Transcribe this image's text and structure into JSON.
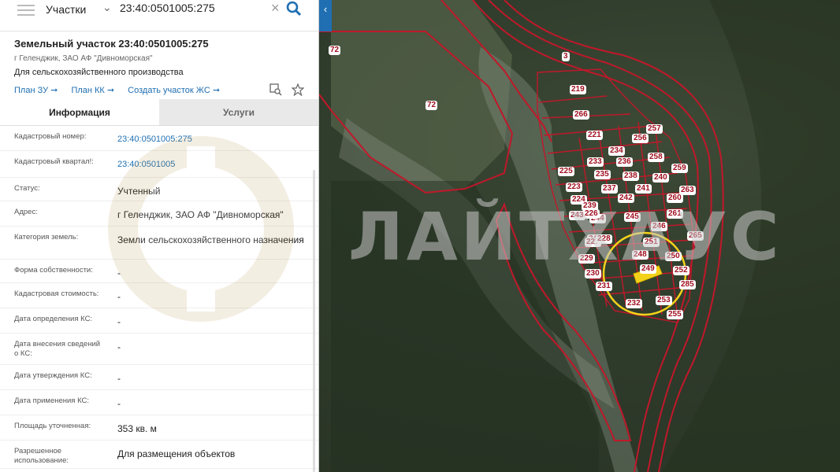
{
  "search": {
    "category": "Участки",
    "query": "23:40:0501005:275"
  },
  "object": {
    "title": "Земельный участок 23:40:0501005:275",
    "location": "г Геленджик, ЗАО АФ \"Дивноморская\"",
    "purpose": "Для сельскохозяйственного производства",
    "links": [
      {
        "label": "План ЗУ"
      },
      {
        "label": "План КК"
      },
      {
        "label": "Создать участок ЖС"
      }
    ]
  },
  "tabs": [
    {
      "label": "Информация",
      "active": true
    },
    {
      "label": "Услуги",
      "active": false
    }
  ],
  "info": [
    {
      "label": "Кадастровый номер:",
      "value": "23:40:0501005:275",
      "link": true
    },
    {
      "label": "Кадастровый квартал!:",
      "value": "23:40:0501005",
      "link": true
    },
    {
      "label": "Статус:",
      "value": "Учтенный"
    },
    {
      "label": "Адрес:",
      "value": "г Геленджик, ЗАО АФ \"Дивноморская\""
    },
    {
      "label": "Категория земель:",
      "value": "Земли сельскохозяйственного назначения"
    },
    {
      "label": "Форма собственности:",
      "value": "-"
    },
    {
      "label": "Кадастровая стоимость:",
      "value": "-"
    },
    {
      "label": "Дата определения КС:",
      "value": "-"
    },
    {
      "label": "Дата внесения сведений о КС:",
      "value": "-"
    },
    {
      "label": "Дата утверждения КС:",
      "value": "-"
    },
    {
      "label": "Дата применения КС:",
      "value": "-"
    },
    {
      "label": "Площадь уточненная:",
      "value": "353 кв. м"
    },
    {
      "label": "Разрешенное использование:",
      "value": "Для размещения объектов"
    }
  ],
  "map": {
    "watermark": "ЛАЙТХАУС",
    "parcels": [
      "72",
      "72",
      "219",
      "266",
      "221",
      "257",
      "256",
      "258",
      "234",
      "233",
      "259",
      "236",
      "235",
      "238",
      "240",
      "223",
      "237",
      "241",
      "224",
      "239",
      "242",
      "243",
      "244",
      "245",
      "246",
      "247",
      "248",
      "249",
      "250",
      "251",
      "252",
      "253",
      "255",
      "229",
      "230",
      "231",
      "232",
      "225",
      "226",
      "227",
      "228",
      "260",
      "261",
      "263",
      "265",
      "285",
      "3"
    ]
  },
  "colors": {
    "accent": "#1f6fb2",
    "parcel_border": "#c0182a",
    "highlight": "#f3d21b"
  }
}
